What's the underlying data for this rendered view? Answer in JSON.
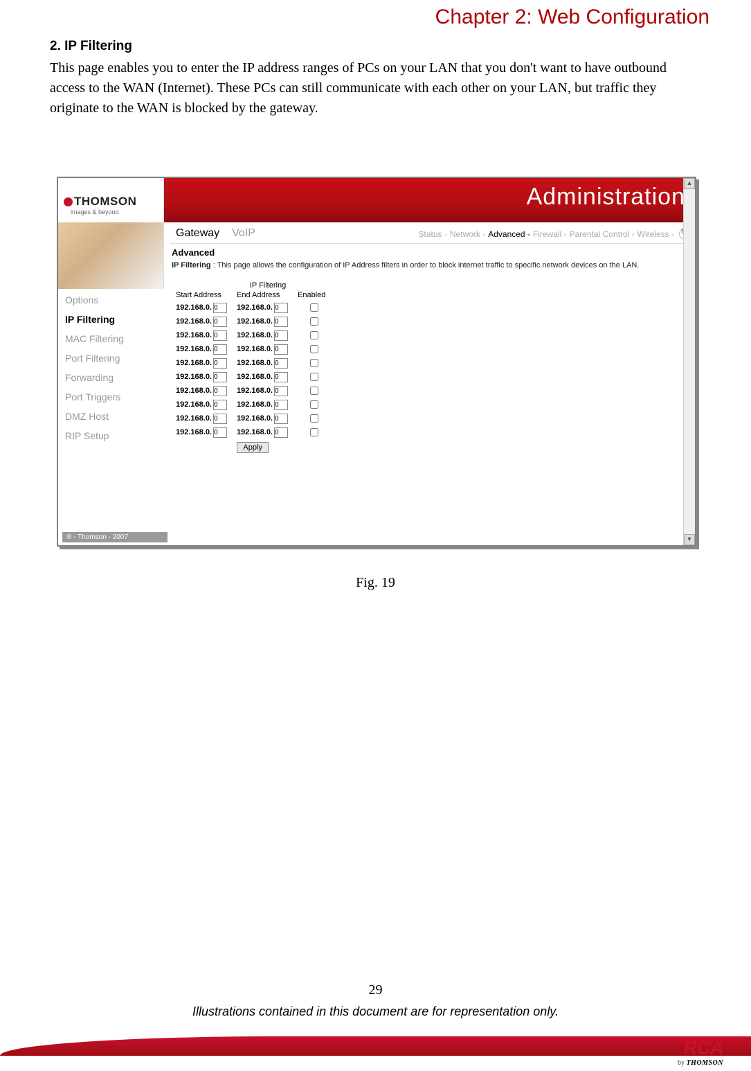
{
  "chapter_title": "Chapter 2: Web Configuration",
  "section_heading": "2. IP Filtering",
  "body_text": "This page enables you to enter the IP address ranges of PCs on your LAN that you don't want to have outbound access to the WAN (Internet). These PCs can still communicate with each other on your LAN, but traffic they originate to the WAN is blocked by the gateway.",
  "screenshot": {
    "banner_title": "Administration",
    "logo_text": "THOMSON",
    "logo_tagline": "images & beyond",
    "main_tabs": [
      {
        "label": "Gateway",
        "active": true
      },
      {
        "label": "VoIP",
        "active": false
      }
    ],
    "sub_tabs": [
      {
        "label": "Status",
        "active": false
      },
      {
        "label": "Network",
        "active": false
      },
      {
        "label": "Advanced",
        "active": true
      },
      {
        "label": "Firewall",
        "active": false
      },
      {
        "label": "Parental Control",
        "active": false
      },
      {
        "label": "Wireless",
        "active": false
      }
    ],
    "sidebar_items": [
      {
        "label": "Options",
        "active": false
      },
      {
        "label": "IP Filtering",
        "active": true
      },
      {
        "label": "MAC Filtering",
        "active": false
      },
      {
        "label": "Port Filtering",
        "active": false
      },
      {
        "label": "Forwarding",
        "active": false
      },
      {
        "label": "Port Triggers",
        "active": false
      },
      {
        "label": "DMZ Host",
        "active": false
      },
      {
        "label": "RIP Setup",
        "active": false
      }
    ],
    "content_title": "Advanced",
    "content_desc_label": "IP Filtering",
    "content_desc_text": " :  This page allows the configuration of IP Address filters in order to block internet traffic to specific network devices on the LAN.",
    "table": {
      "caption": "IP Filtering",
      "headers": {
        "start": "Start Address",
        "end": "End Address",
        "enabled": "Enabled"
      },
      "ip_prefix": "192.168.0.",
      "rows": [
        {
          "start_octet": "0",
          "end_octet": "0",
          "enabled": false
        },
        {
          "start_octet": "0",
          "end_octet": "0",
          "enabled": false
        },
        {
          "start_octet": "0",
          "end_octet": "0",
          "enabled": false
        },
        {
          "start_octet": "0",
          "end_octet": "0",
          "enabled": false
        },
        {
          "start_octet": "0",
          "end_octet": "0",
          "enabled": false
        },
        {
          "start_octet": "0",
          "end_octet": "0",
          "enabled": false
        },
        {
          "start_octet": "0",
          "end_octet": "0",
          "enabled": false
        },
        {
          "start_octet": "0",
          "end_octet": "0",
          "enabled": false
        },
        {
          "start_octet": "0",
          "end_octet": "0",
          "enabled": false
        },
        {
          "start_octet": "0",
          "end_octet": "0",
          "enabled": false
        }
      ],
      "apply_label": "Apply"
    },
    "footer_copy": "® - Thomson - 2007"
  },
  "figure_caption": "Fig. 19",
  "page_number": "29",
  "disclaimer": "Illustrations contained in this document are for representation only.",
  "footer": {
    "rca": "RCA",
    "by": "by ",
    "thomson": "THOMSON"
  }
}
